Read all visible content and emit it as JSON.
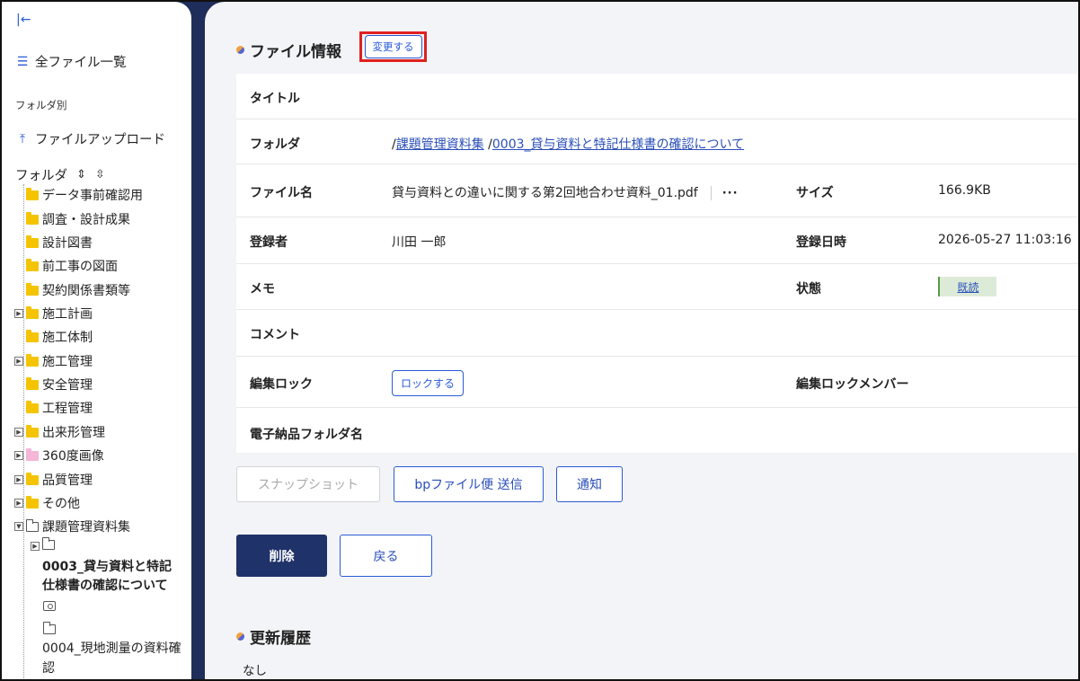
{
  "sidebar": {
    "all_files": "全ファイル一覧",
    "by_folder_label": "フォルダ別",
    "upload": "ファイルアップロード",
    "folder_header": "フォルダ",
    "expand_all": "⇕",
    "collapse_all": "⇳",
    "tree": [
      {
        "label": "データ事前確認用",
        "expandable": false,
        "color": "yellow"
      },
      {
        "label": "調査・設計成果",
        "expandable": false,
        "color": "yellow"
      },
      {
        "label": "設計図書",
        "expandable": false,
        "color": "yellow"
      },
      {
        "label": "前工事の図面",
        "expandable": false,
        "color": "yellow"
      },
      {
        "label": "契約関係書類等",
        "expandable": false,
        "color": "yellow"
      },
      {
        "label": "施工計画",
        "expandable": true,
        "color": "yellow"
      },
      {
        "label": "施工体制",
        "expandable": false,
        "color": "yellow"
      },
      {
        "label": "施工管理",
        "expandable": true,
        "color": "yellow"
      },
      {
        "label": "安全管理",
        "expandable": false,
        "color": "yellow"
      },
      {
        "label": "工程管理",
        "expandable": false,
        "color": "yellow"
      },
      {
        "label": "出来形管理",
        "expandable": true,
        "color": "yellow"
      },
      {
        "label": "360度画像",
        "expandable": true,
        "color": "pink"
      },
      {
        "label": "品質管理",
        "expandable": true,
        "color": "yellow"
      },
      {
        "label": "その他",
        "expandable": true,
        "color": "yellow"
      },
      {
        "label": "課題管理資料集",
        "expandable": true,
        "color": "outline"
      }
    ],
    "sub_selected_line1": "0003_貸与資料と特記",
    "sub_selected_line2": "仕様書の確認について",
    "sub_other_line1": "0004_現地測量の資料確",
    "sub_other_line2": "認"
  },
  "main": {
    "section_title": "ファイル情報",
    "change_button": "変更する",
    "fields": {
      "title_label": "タイトル",
      "folder_label": "フォルダ",
      "folder_path_1": "課題管理資料集",
      "folder_path_2": "0003_貸与資料と特記仕様書の確認について",
      "filename_label": "ファイル名",
      "filename_value": "貸与資料との違いに関する第2回地合わせ資料_01.pdf",
      "more": "···",
      "size_label": "サイズ",
      "size_value": "166.9KB",
      "registrant_label": "登録者",
      "registrant_value": "川田 一郎",
      "reg_date_label": "登録日時",
      "reg_date_value": "2026-05-27 11:03:16",
      "memo_label": "メモ",
      "status_label": "状態",
      "status_value": "既読",
      "comment_label": "コメント",
      "lock_label": "編集ロック",
      "lock_button": "ロックする",
      "lock_member_label": "編集ロックメンバー",
      "edeliv_label": "電子納品フォルダ名"
    },
    "buttons": {
      "snapshot": "スナップショット",
      "bp_send": "bpファイル便 送信",
      "notify": "通知",
      "delete": "削除",
      "back": "戻る"
    },
    "history_title": "更新履歴",
    "history_none": "なし"
  }
}
